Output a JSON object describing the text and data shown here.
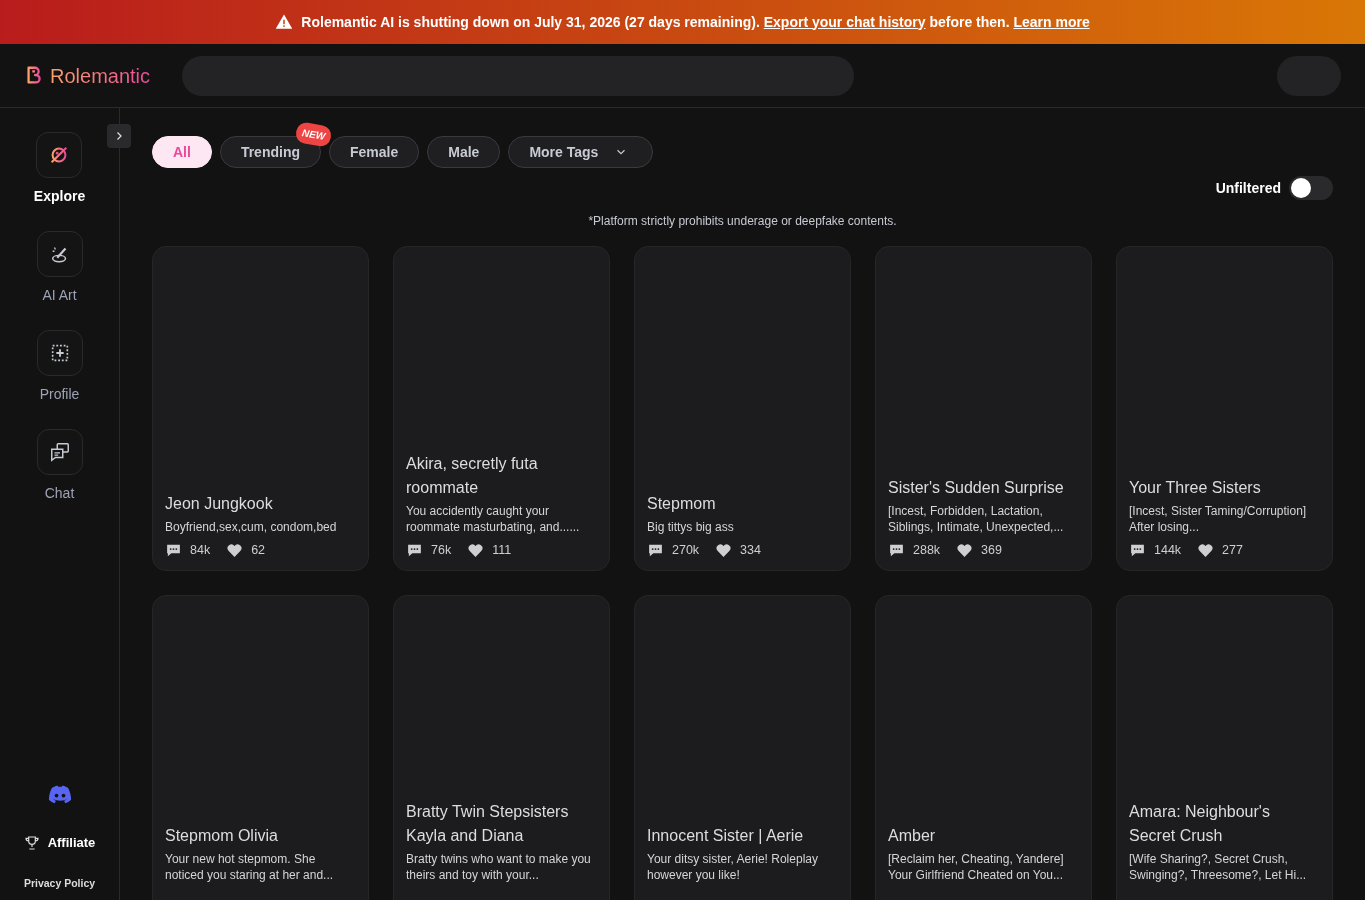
{
  "banner": {
    "text": "Rolemantic AI is shutting down on July 31, 2026 (27 days remaining).",
    "link_1": "Export your chat history",
    "middle": "before then.",
    "link_2": "Learn more"
  },
  "header": {
    "logo": "Rolemantic"
  },
  "sidebar": {
    "items": [
      {
        "label": "Explore",
        "kind": "explore",
        "selected": true
      },
      {
        "label": "AI Art",
        "kind": "art",
        "selected": false
      },
      {
        "label": "Profile",
        "kind": "profile",
        "selected": false
      },
      {
        "label": "Chat",
        "kind": "chat",
        "selected": false
      }
    ],
    "affiliate": "Affiliate",
    "privacy": "Privacy Policy"
  },
  "filters": [
    {
      "label": "All",
      "selected": true
    },
    {
      "label": "Trending",
      "selected": false,
      "badge": "NEW"
    },
    {
      "label": "Female",
      "selected": false
    },
    {
      "label": "Male",
      "selected": false
    },
    {
      "label": "More Tags",
      "selected": false,
      "dropdown": true
    }
  ],
  "unfiltered": {
    "label": "Unfiltered",
    "on": false
  },
  "notice": "*Platform strictly prohibits underage or deepfake contents.",
  "cards": [
    {
      "title": "Jeon Jungkook",
      "description": "Boyfriend,sex,cum, condom,bed",
      "chats": "84k",
      "likes": "62"
    },
    {
      "title": "Akira, secretly futa roommate",
      "description": "You accidently caught your roommate masturbating, and......",
      "chats": "76k",
      "likes": "111"
    },
    {
      "title": "Stepmom",
      "description": "Big tittys big ass",
      "chats": "270k",
      "likes": "334"
    },
    {
      "title": "Sister's Sudden Surprise",
      "description": "[Incest, Forbidden, Lactation, Siblings, Intimate, Unexpected,...",
      "chats": "288k",
      "likes": "369"
    },
    {
      "title": "Your Three Sisters",
      "description": "[Incest, Sister Taming/Corruption] After losing...",
      "chats": "144k",
      "likes": "277"
    },
    {
      "title": "Stepmom Olivia",
      "description": "Your new hot stepmom. She noticed you staring at her and..."
    },
    {
      "title": "Bratty Twin Stepsisters Kayla and Diana",
      "description": "Bratty twins who want to make you theirs and toy with your..."
    },
    {
      "title": "Innocent Sister | Aerie",
      "description": "Your ditsy sister, Aerie! Roleplay however you like!"
    },
    {
      "title": "Amber",
      "description": "[Reclaim her, Cheating, Yandere] Your Girlfriend Cheated on You..."
    },
    {
      "title": "Amara: Neighbour's Secret Crush",
      "description": "[Wife Sharing?, Secret Crush, Swinging?, Threesome?, Let Hi..."
    }
  ]
}
